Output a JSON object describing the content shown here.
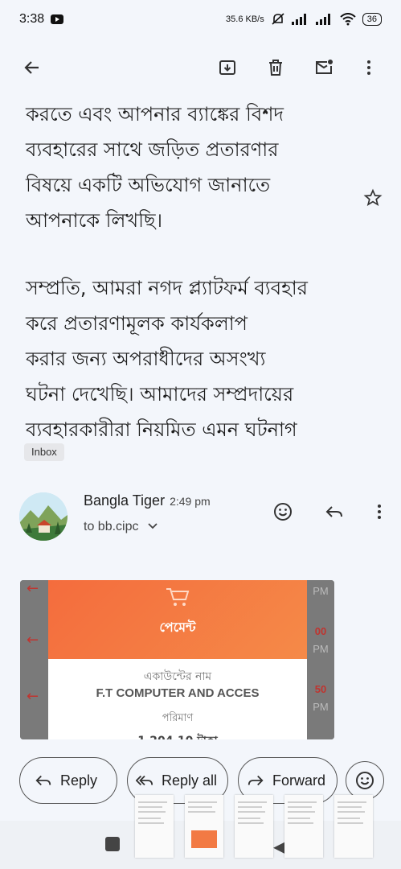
{
  "status": {
    "time": "3:38",
    "data_speed": "35.6 KB/s",
    "battery": "36"
  },
  "email": {
    "paragraphs": [
      "করতে এবং আপনার ব্যাঙ্কের বিশদ\nব্যবহারের সাথে জড়িত প্রতারণার\nবিষয়ে একটি অভিযোগ জানাতে\nআপনাকে লিখছি।",
      "সম্প্রতি, আমরা নগদ প্ল্যাটফর্ম ব্যবহার\nকরে প্রতারণামূলক কার্যকলাপ\nকরার জন্য অপরাধীদের অসংখ্য\nঘটনা দেখেছি। আমাদের সম্প্রদায়ের\nব্যবহারকারীরা নিয়মিত এমন ঘটনাগ"
    ],
    "label": "Inbox"
  },
  "sender": {
    "name": "Bangla Tiger",
    "time": "2:49 pm",
    "recipient": "to bb.cipc"
  },
  "attachment": {
    "payment_title": "পেমেন্ট",
    "account_label": "একাউন্টের নাম",
    "account_name": "F.T COMPUTER AND ACCES",
    "amount_label": "পরিমাণ",
    "amount": "1,204.10 টাকা",
    "side_texts": [
      "PM",
      "00",
      "PM",
      "50",
      "PM"
    ]
  },
  "actions": {
    "reply": "Reply",
    "reply_all": "Reply all",
    "forward": "Forward"
  },
  "icons": [
    "back-arrow-icon",
    "archive-icon",
    "delete-icon",
    "mark-unread-icon",
    "more-vert-icon",
    "star-icon",
    "emoji-icon",
    "reply-icon",
    "reply-all-icon",
    "forward-icon",
    "chevron-down-icon"
  ]
}
